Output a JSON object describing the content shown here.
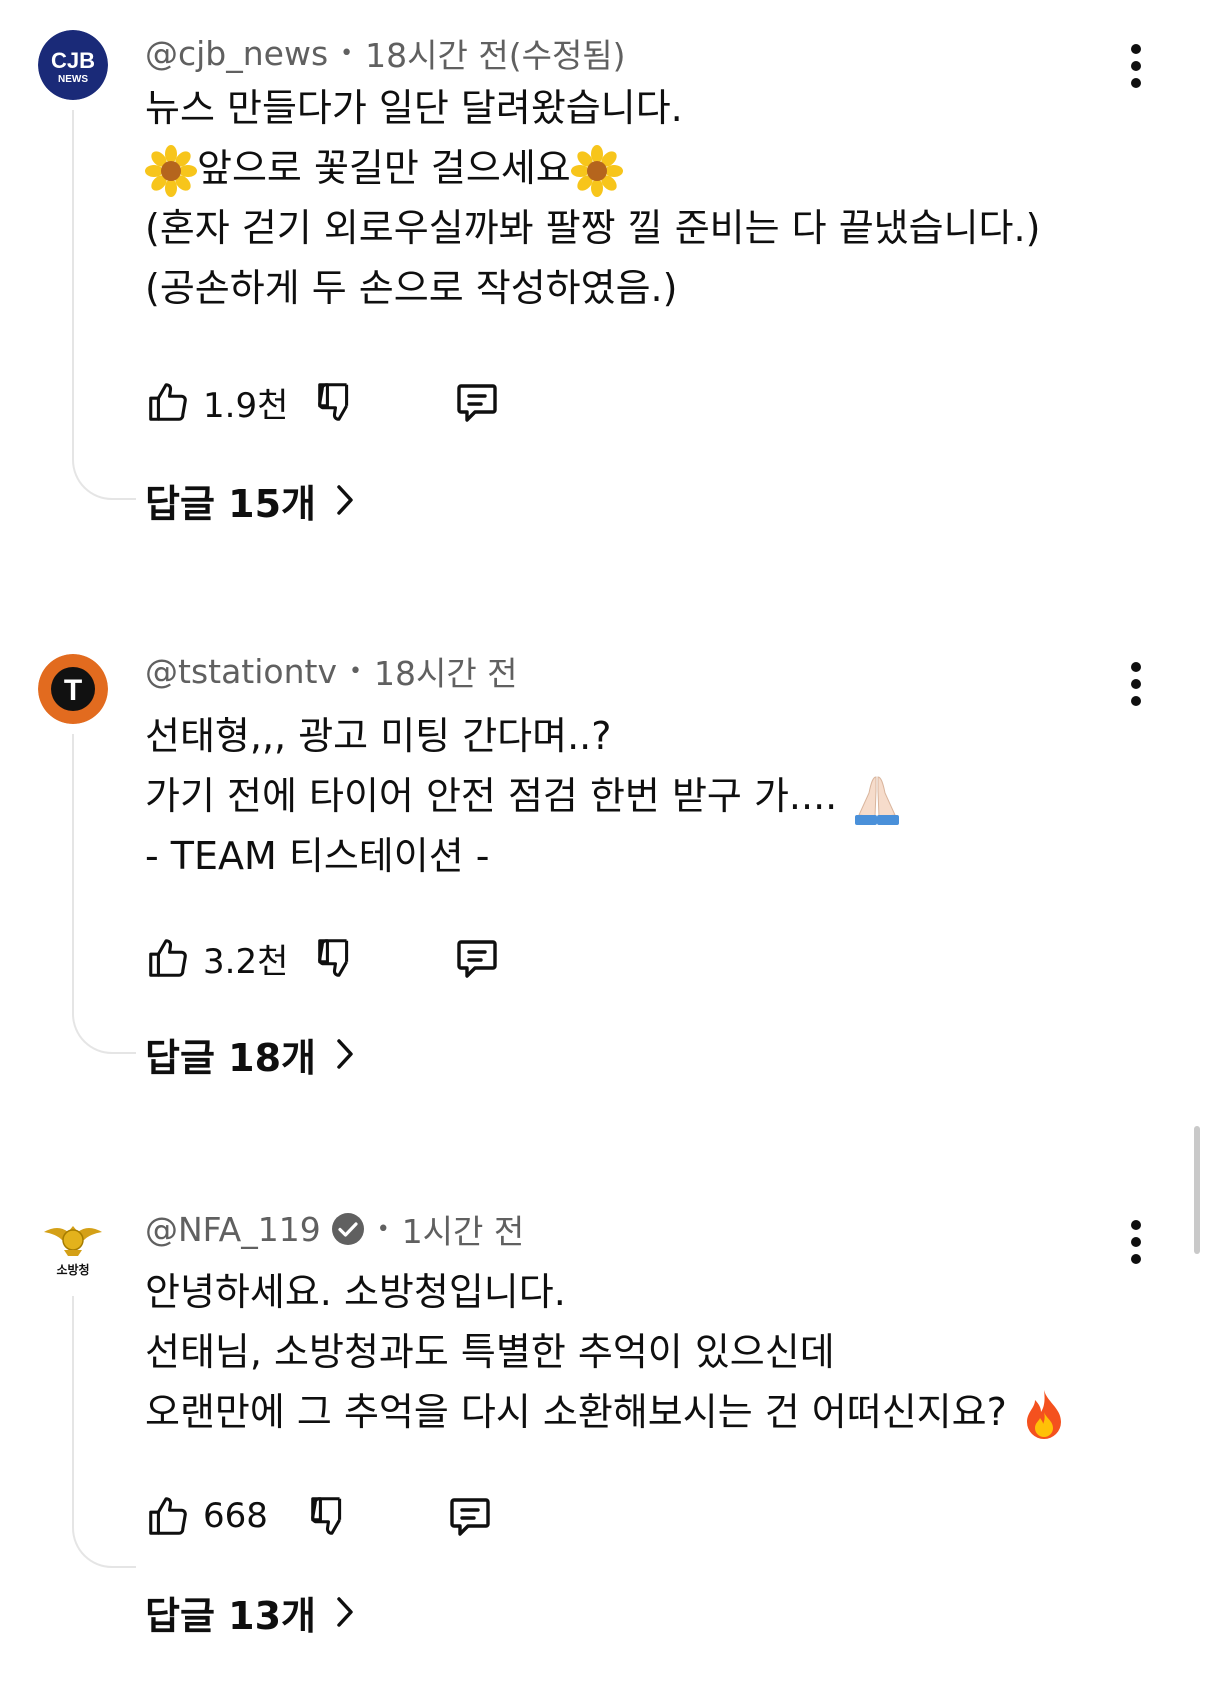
{
  "comments": [
    {
      "handle": "@cjb_news",
      "time": "18시간 전(수정됨)",
      "verified": false,
      "avatar_label": "CJB",
      "avatar_sub": "NEWS",
      "lines": [
        "뉴스 만들다가 일단 달려왔습니다.",
        "앞으로 꽃길만 걸으세요",
        "(혼자 걷기 외로우실까봐 팔짱 낄 준비는 다 끝냈습니다.)",
        "(공손하게 두 손으로 작성하였음.)"
      ],
      "likes": "1.9천",
      "replies_label": "답글 15개"
    },
    {
      "handle": "@tstationtv",
      "time": "18시간 전",
      "verified": false,
      "avatar_label": "T",
      "lines": [
        "선태형,,, 광고 미팅 간다며..?",
        "가기 전에 타이어 안전 점검 한번 받구 가....",
        "- TEAM 티스테이션  -"
      ],
      "likes": "3.2천",
      "replies_label": "답글 18개"
    },
    {
      "handle": "@NFA_119",
      "time": "1시간 전",
      "verified": true,
      "avatar_label": "소방청",
      "lines": [
        "안녕하세요. 소방청입니다.",
        "선태님, 소방청과도 특별한 추억이 있으신데",
        "오랜만에 그 추억을 다시 소환해보시는 건 어떠신지요?"
      ],
      "likes": "668",
      "replies_label": "답글 13개"
    }
  ],
  "separator": "•",
  "icons": {
    "like": "thumbs-up-icon",
    "dislike": "thumbs-down-icon",
    "reply": "comment-icon",
    "more": "more-vertical-icon",
    "chevron": "chevron-right-icon",
    "verified": "verified-check-icon",
    "flower": "sunflower-emoji",
    "pray": "folded-hands-emoji",
    "fire": "fire-emoji"
  },
  "colors": {
    "text": "#0f0f0f",
    "meta": "#606060",
    "thread_line": "#e5e5e5",
    "cjb_avatar": "#1a2a78",
    "tstation_avatar": "#e26b1f"
  }
}
